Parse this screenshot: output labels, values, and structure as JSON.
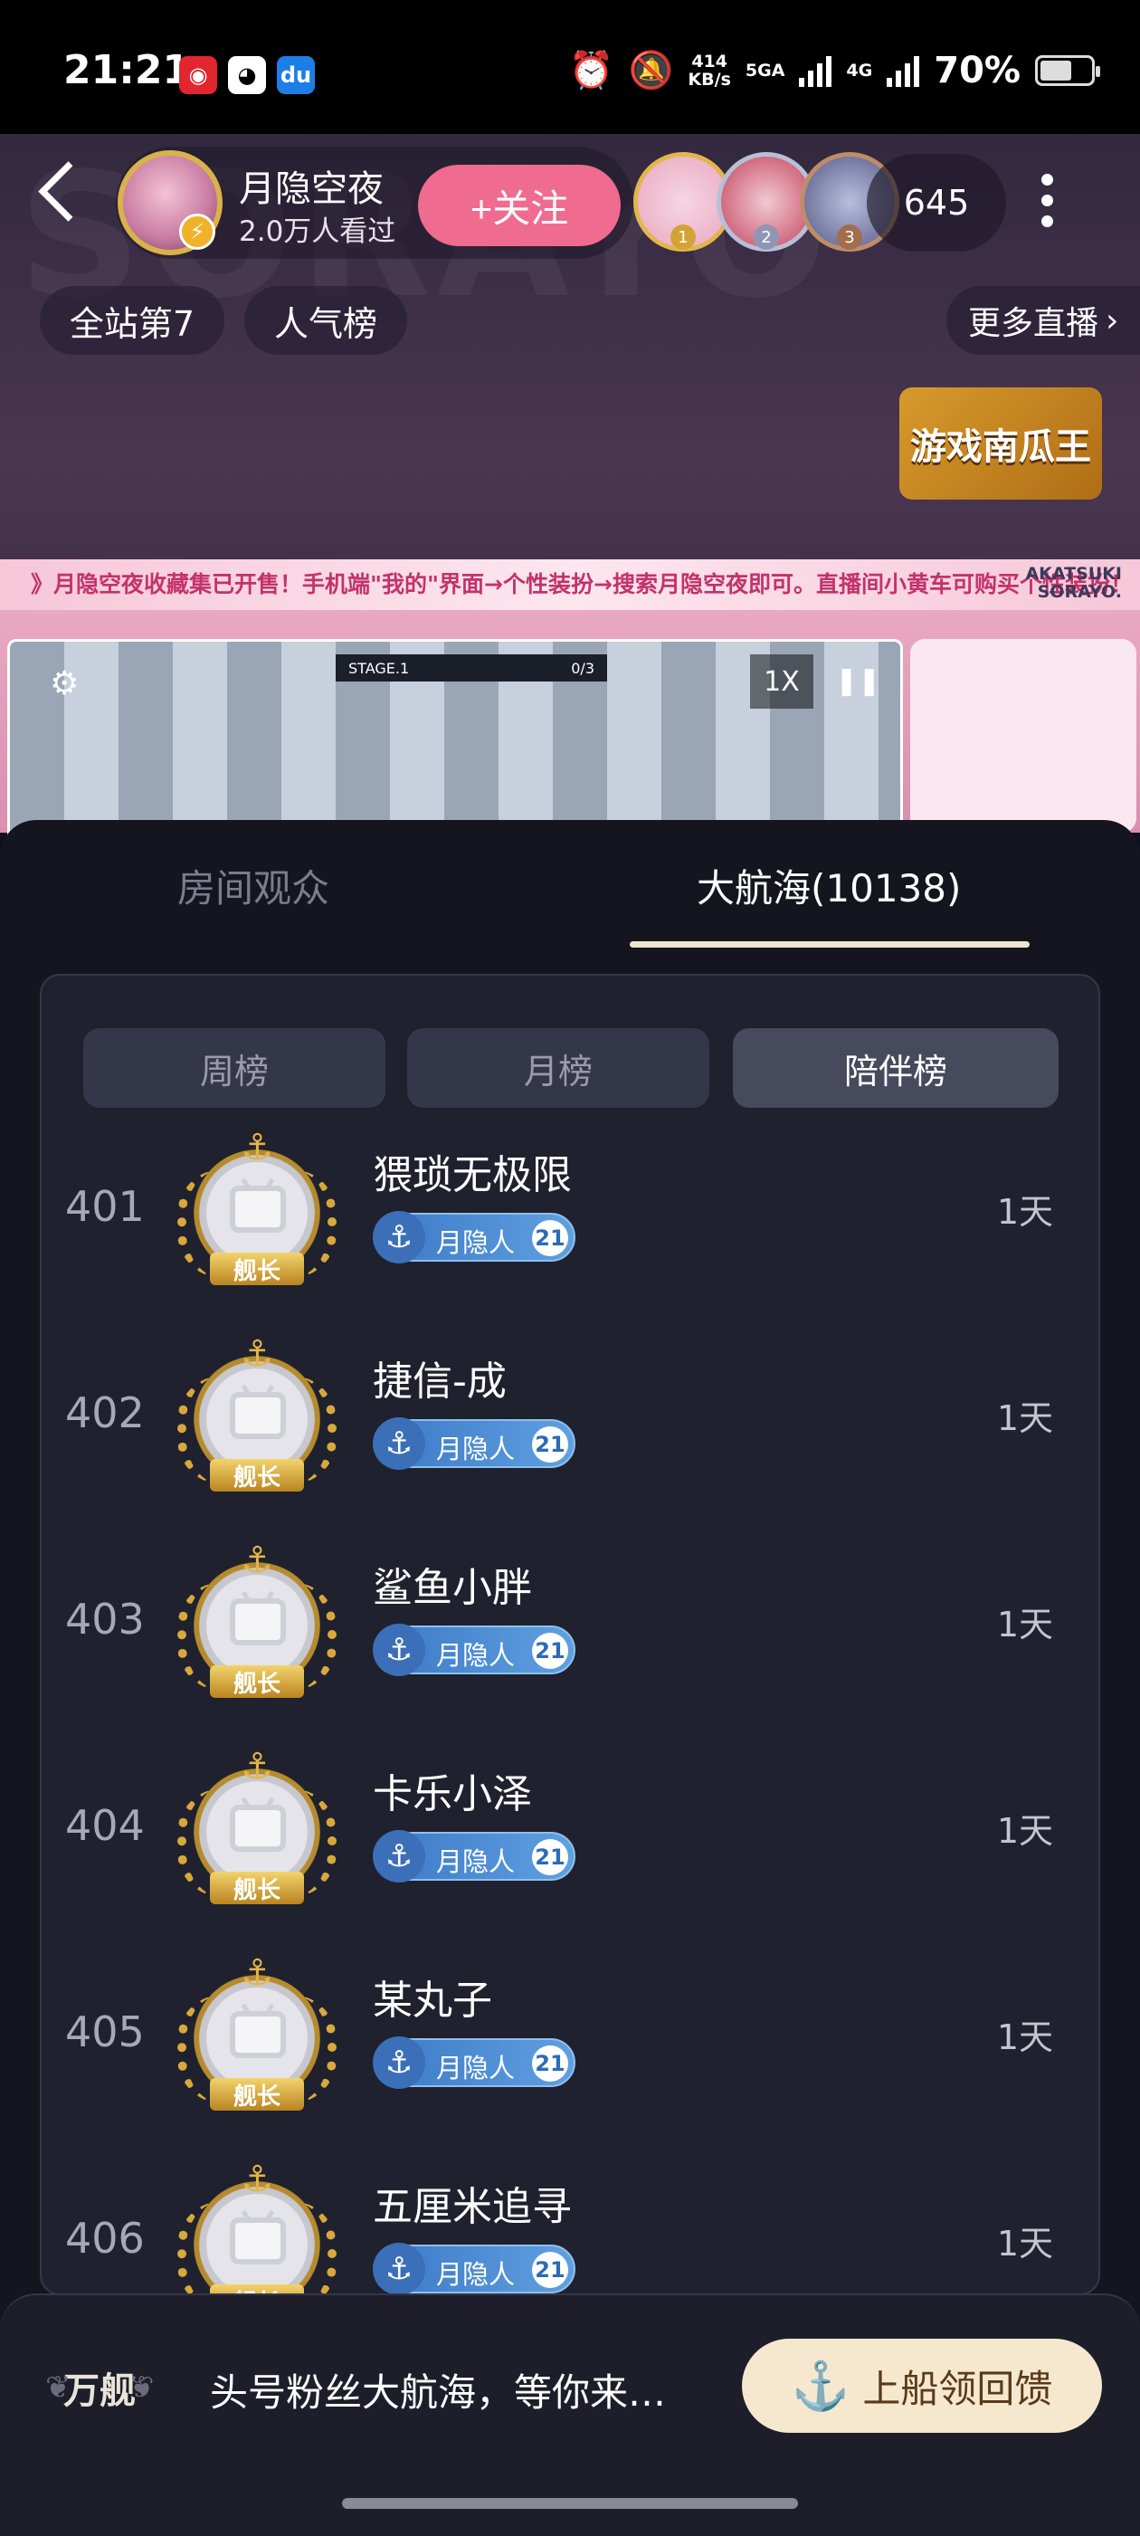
{
  "status_bar": {
    "time": "21:21",
    "net_speed": "414",
    "net_unit": "KB/s",
    "sig1": "5GA",
    "sig2": "4G",
    "battery": "70%"
  },
  "host": {
    "name": "月隐空夜",
    "watching": "2.0万人看过",
    "follow_label": "+关注",
    "online_count": "645"
  },
  "top_rank_numbers": [
    "1",
    "2",
    "3"
  ],
  "tags": [
    "全站第7",
    "人气榜"
  ],
  "more_live": "更多直播",
  "game_ad": "游戏南瓜王",
  "banner": {
    "text": "》月隐空夜收藏集已开售！手机端\"我的\"界面→个性装扮→搜索月隐空夜即可。直播间小黄车可购买个性装扮！《",
    "logo_line1": "AKATSUKI",
    "logo_line2": "SORAYO."
  },
  "game_view": {
    "stage": "STAGE.1",
    "progress": "0/3",
    "speed": "1X"
  },
  "tabs": {
    "audience": "房间观众",
    "guard": "大航海(10138)"
  },
  "subtabs": [
    "周榜",
    "月榜",
    "陪伴榜"
  ],
  "members": [
    {
      "rank": "401",
      "name": "猥琐无极限",
      "badge": "月隐人",
      "level": "21",
      "days": "1天"
    },
    {
      "rank": "402",
      "name": "捷信-成",
      "badge": "月隐人",
      "level": "21",
      "days": "1天"
    },
    {
      "rank": "403",
      "name": "鲨鱼小胖",
      "badge": "月隐人",
      "level": "21",
      "days": "1天"
    },
    {
      "rank": "404",
      "name": "卡乐小泽",
      "badge": "月隐人",
      "level": "21",
      "days": "1天"
    },
    {
      "rank": "405",
      "name": "某丸子",
      "badge": "月隐人",
      "level": "21",
      "days": "1天"
    },
    {
      "rank": "406",
      "name": "五厘米追寻",
      "badge": "月隐人",
      "level": "21",
      "days": "1天"
    }
  ],
  "medal_label": "舰长",
  "footer": {
    "logo": "万舰",
    "promo": "头号粉丝大航海，等你来…",
    "cta": "上船领回馈"
  }
}
